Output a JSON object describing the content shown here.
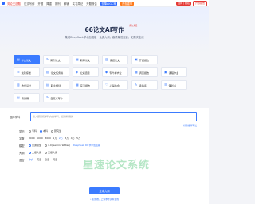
{
  "topnav": {
    "items": [
      "务论文选题",
      "论文写作",
      "开题",
      "降重",
      "期刊",
      "教辅",
      "实习周记",
      "开题报告"
    ],
    "badge1": "去降AIGC率",
    "badge2": "去查重率",
    "action1": "自律 | 报名",
    "action2": "开题报告"
  },
  "hero": {
    "title": "66论文AI写作",
    "tag": "永久免费",
    "subtitle": "集成DeepSeek学术加强版 · 免费大纲，高质量低查重，无限次生成"
  },
  "cards": [
    [
      {
        "icon": "document-icon",
        "glyph": "▤",
        "label": "毕业论文",
        "active": true
      },
      {
        "icon": "pen-icon",
        "glyph": "✎",
        "label": "期刊论文"
      },
      {
        "icon": "book-icon",
        "glyph": "▦",
        "label": "职称论文"
      },
      {
        "icon": "report-icon",
        "glyph": "▥",
        "label": "课题论文"
      },
      {
        "icon": "clipboard-icon",
        "glyph": "▣",
        "label": "开题报告"
      }
    ],
    [
      {
        "icon": "review-icon",
        "glyph": "☰",
        "label": "文献综述"
      },
      {
        "icon": "docs-icon",
        "glyph": "▤",
        "label": "论文任务书"
      },
      {
        "icon": "topic-icon",
        "glyph": "◈",
        "label": "论文选题"
      },
      {
        "icon": "cap-icon",
        "glyph": "◆",
        "label": "专升本毕业"
      },
      {
        "icon": "survey-icon",
        "glyph": "▦",
        "label": "调查报告"
      },
      {
        "icon": "course-icon",
        "glyph": "▣",
        "label": "课程作业"
      }
    ],
    [
      {
        "icon": "chart-icon",
        "glyph": "▥",
        "label": "教学设计"
      },
      {
        "icon": "briefcase-icon",
        "glyph": "▤",
        "label": "职业规划"
      },
      {
        "icon": "bars-icon",
        "glyph": "▦",
        "label": "实习报告"
      },
      {
        "icon": "heart-icon",
        "glyph": "♡",
        "label": "心得体会"
      },
      {
        "icon": "note-icon",
        "glyph": "✎",
        "label": "读后感"
      },
      {
        "icon": "plan-icon",
        "glyph": "☰",
        "label": "策划书"
      }
    ],
    [
      {
        "icon": "speech-icon",
        "glyph": "▤",
        "label": "演讲稿"
      },
      {
        "icon": "custom-icon",
        "glyph": "✎",
        "label": "自定义写作"
      }
    ]
  ],
  "form": {
    "title_label": "选择学科",
    "title_placeholder": "输入题目和学科文章学科，提供精确的",
    "hint": "标题推荐写法",
    "degree_label": "学历",
    "degree_options": [
      "专科",
      "本科",
      "研究生"
    ],
    "degree_selected": 1,
    "words_label": "字数",
    "word_options": [
      "3000",
      "5000",
      "8000",
      "1万",
      "2万",
      "3万",
      "4万",
      "5万"
    ],
    "word_selected": 4,
    "model_label": "模型",
    "model_options": [
      "普通模型",
      "4.0(Gemini Writer)"
    ],
    "model_note": "DeepSeek R1 学术加强版",
    "outline_label": "大纲",
    "outline_options": [
      "二级大纲",
      "三级大纲"
    ],
    "lang_label": "语言",
    "lang_options": [
      "中文",
      "英语",
      "日语",
      "韩语"
    ],
    "submit": "生成大纲",
    "footer": "• 论题推，上传参考资料生成",
    "watermark": "星速论文",
    "watermark2": "系统"
  }
}
